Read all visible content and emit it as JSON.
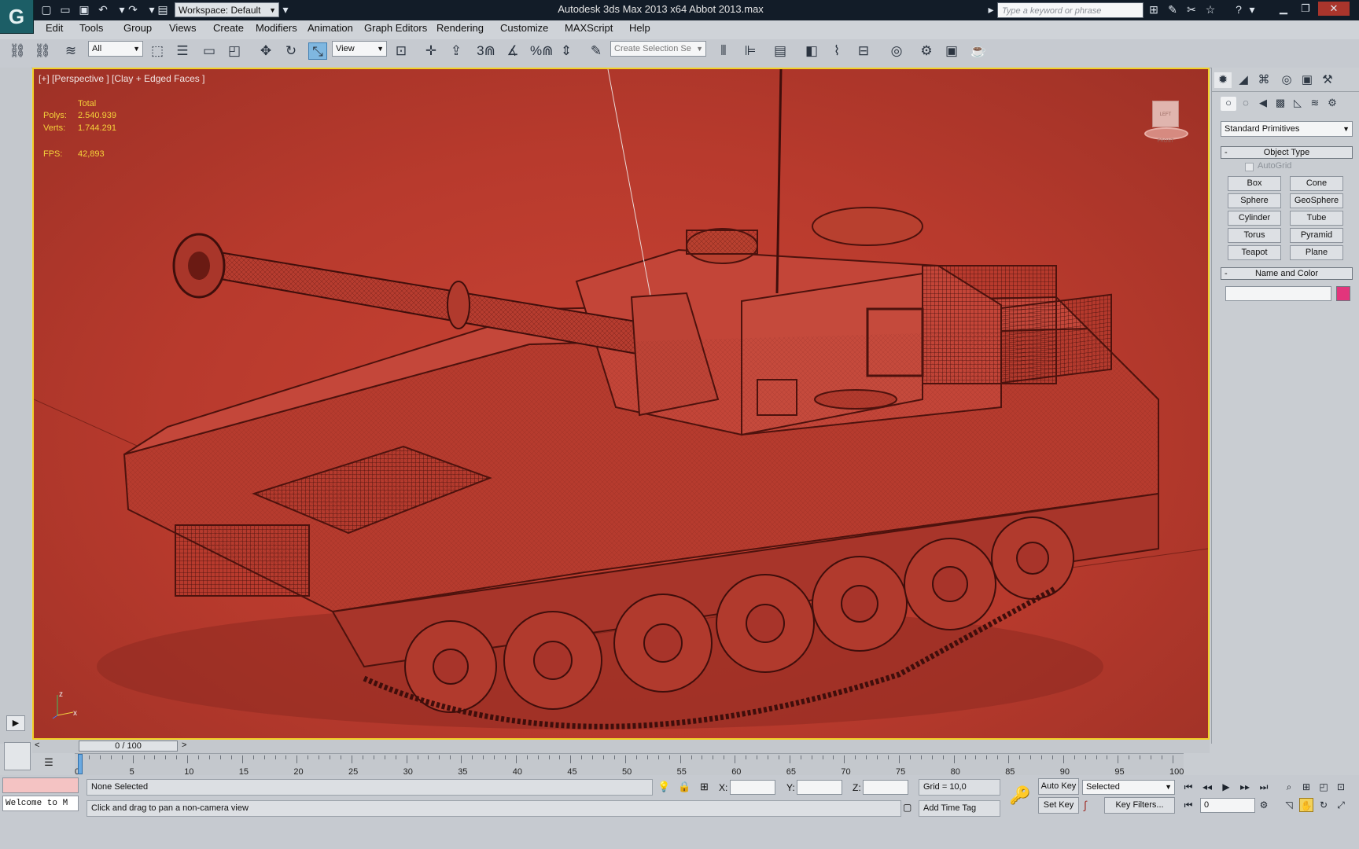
{
  "app": {
    "logo": "G",
    "window_title": "Autodesk 3ds Max 2013 x64     Abbot 2013.max",
    "workspace_label": "Workspace: Default",
    "search_placeholder": "Type a keyword or phrase"
  },
  "menu": [
    "Edit",
    "Tools",
    "Group",
    "Views",
    "Create",
    "Modifiers",
    "Animation",
    "Graph Editors",
    "Rendering",
    "Customize",
    "MAXScript",
    "Help"
  ],
  "toolbar": {
    "filter_select": "All",
    "ref_coord_select": "View",
    "named_selection_placeholder": "Create Selection Se",
    "snap_label": "3",
    "percent_snap_label": "%"
  },
  "viewport": {
    "label": "[+] [Perspective ] [Clay + Edged Faces ]",
    "stats": {
      "total_label": "Total",
      "polys_label": "Polys:",
      "polys_value": "2.540.939",
      "verts_label": "Verts:",
      "verts_value": "1.744.291",
      "fps_label": "FPS:",
      "fps_value": "42,893"
    },
    "axis_z": "z",
    "axis_x": "x",
    "viewcube_label": "LEFT FRONT",
    "bg_color": "#c14034",
    "wire_color": "#5a1510"
  },
  "command_panel": {
    "category_select": "Standard Primitives",
    "object_type_title": "Object Type",
    "autogrid_label": "AutoGrid",
    "primitives": [
      "Box",
      "Cone",
      "Sphere",
      "GeoSphere",
      "Cylinder",
      "Tube",
      "Torus",
      "Pyramid",
      "Teapot",
      "Plane"
    ],
    "name_color_title": "Name and Color",
    "name_value": "",
    "object_color": "#e2357c"
  },
  "time_slider": {
    "frame_display": "0 / 100",
    "prev_label": "<",
    "next_label": ">"
  },
  "track_ticks": [
    "0",
    "5",
    "10",
    "15",
    "20",
    "25",
    "30",
    "35",
    "40",
    "45",
    "50",
    "55",
    "60",
    "65",
    "70",
    "75",
    "80",
    "85",
    "90",
    "95",
    "100"
  ],
  "status": {
    "maxscript_listener": "Welcome to M",
    "selection_text": "None Selected",
    "prompt_text": "Click and drag to pan a non-camera view",
    "x_label": "X:",
    "y_label": "Y:",
    "z_label": "Z:",
    "x_value": "",
    "y_value": "",
    "z_value": "",
    "grid_text": "Grid = 10,0",
    "add_time_tag": "Add Time Tag",
    "auto_key": "Auto Key",
    "set_key": "Set Key",
    "selected_select": "Selected",
    "key_filters": "Key Filters...",
    "frame_field": "0"
  }
}
